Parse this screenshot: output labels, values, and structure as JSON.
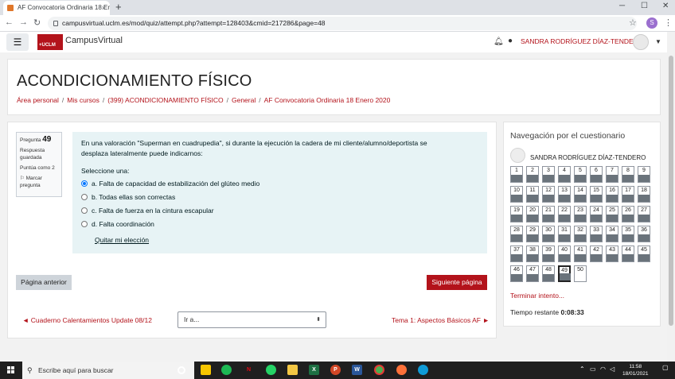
{
  "browser": {
    "tab_title": "AF Convocatoria Ordinaria 18 Ene",
    "tab_close": "×",
    "new_tab": "+",
    "url": "campusvirtual.uclm.es/mod/quiz/attempt.php?attempt=128403&cmid=217286&page=48",
    "profile_initial": "S",
    "window_controls": [
      "─",
      "☐",
      "✕"
    ]
  },
  "navbar": {
    "site_name": "CampusVirtual",
    "logo_text": "+UCLM",
    "user_name": "SANDRA RODRÍGUEZ DÍAZ-TENDERO"
  },
  "header": {
    "title": "ACONDICIONAMIENTO FÍSICO",
    "breadcrumb": [
      "Área personal",
      "Mis cursos",
      "(399) ACONDICIONAMIENTO FÍSICO",
      "General",
      "AF Convocatoria Ordinaria 18 Enero 2020"
    ]
  },
  "question_info": {
    "label": "Pregunta",
    "number": "49",
    "status": "Respuesta guardada",
    "points": "Puntúa como 2",
    "flag": "Marcar pregunta"
  },
  "question": {
    "text": "En una valoración \"Superman en cuadrupedia\", si durante la ejecución la cadera de mi cliente/alumno/deportista se desplaza lateralmente puede indicarnos:",
    "prompt": "Seleccione una:",
    "answers": [
      {
        "label": "a. Falta de capacidad de estabilización del glúteo medio",
        "checked": true
      },
      {
        "label": "b. Todas ellas son correctas",
        "checked": false
      },
      {
        "label": "c. Falta de fuerza en la cintura escapular",
        "checked": false
      },
      {
        "label": "d. Falta coordinación",
        "checked": false
      }
    ],
    "clear_label": "Quitar mi elección"
  },
  "nav_buttons": {
    "prev": "Página anterior",
    "next": "Siguiente página"
  },
  "footer_nav": {
    "prev_link": "◄ Cuaderno Calentamientos Update 08/12",
    "jump_label": "Ir a...",
    "next_link": "Tema 1: Aspectos Básicos AF ►"
  },
  "quiz_nav": {
    "title": "Navegación por el cuestionario",
    "user": "SANDRA RODRÍGUEZ DÍAZ-TENDERO",
    "questions": [
      "1",
      "2",
      "3",
      "4",
      "5",
      "6",
      "7",
      "8",
      "9",
      "10",
      "11",
      "12",
      "13",
      "14",
      "15",
      "16",
      "17",
      "18",
      "19",
      "20",
      "21",
      "22",
      "23",
      "24",
      "25",
      "26",
      "27",
      "28",
      "29",
      "30",
      "31",
      "32",
      "33",
      "34",
      "35",
      "36",
      "37",
      "38",
      "39",
      "40",
      "41",
      "42",
      "43",
      "44",
      "45",
      "46",
      "47",
      "48",
      "49",
      "50"
    ],
    "answered_count": 49,
    "current": 49,
    "finish": "Terminar intento...",
    "time_label": "Tiempo restante",
    "time_value": "0:08:33"
  },
  "taskbar": {
    "search_placeholder": "Escribe aquí para buscar",
    "time": "11:58",
    "date": "18/01/2021"
  }
}
